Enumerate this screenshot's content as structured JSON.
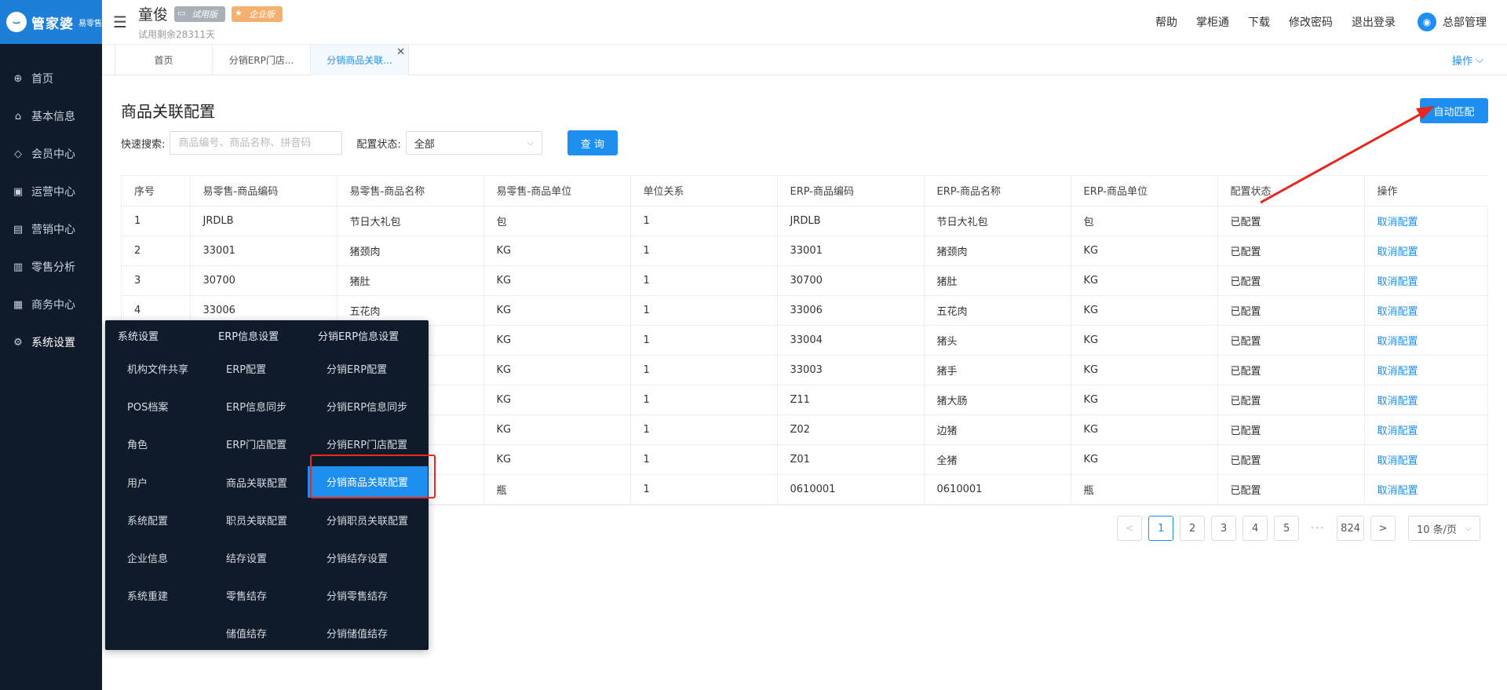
{
  "sidebar": {
    "logo_text": "管家婆",
    "logo_sub": "易零售",
    "items": [
      {
        "label": "首页",
        "icon": "globe-icon",
        "glyph": "⊕"
      },
      {
        "label": "基本信息",
        "icon": "home-icon",
        "glyph": "⌂"
      },
      {
        "label": "会员中心",
        "icon": "diamond-icon",
        "glyph": "◇"
      },
      {
        "label": "运营中心",
        "icon": "operations-icon",
        "glyph": "▣"
      },
      {
        "label": "营销中心",
        "icon": "gift-icon",
        "glyph": "▤"
      },
      {
        "label": "零售分析",
        "icon": "bar-chart-icon",
        "glyph": "▥"
      },
      {
        "label": "商务中心",
        "icon": "briefcase-icon",
        "glyph": "▦"
      },
      {
        "label": "系统设置",
        "icon": "gear-icon",
        "glyph": "⚙"
      }
    ]
  },
  "header": {
    "user_name": "童俊",
    "badge_trial": "试用版",
    "badge_enterprise": "企业版",
    "trial_remaining": "试用剩余28311天",
    "links": [
      "帮助",
      "掌柜通",
      "下载",
      "修改密码",
      "退出登录"
    ],
    "admin_label": "总部管理"
  },
  "tabs": {
    "items": [
      "首页",
      "分销ERP门店...",
      "分销商品关联..."
    ],
    "active_index": 2,
    "ops_label": "操作"
  },
  "main": {
    "title": "商品关联配置",
    "auto_match_label": "自动匹配",
    "search_label": "快速搜索:",
    "search_placeholder": "商品编号、商品名称、拼音码",
    "status_label": "配置状态:",
    "status_value": "全部",
    "query_label": "查 询"
  },
  "table": {
    "headers": [
      "序号",
      "易零售-商品编码",
      "易零售-商品名称",
      "易零售-商品单位",
      "单位关系",
      "ERP-商品编码",
      "ERP-商品名称",
      "ERP-商品单位",
      "配置状态",
      "操作"
    ],
    "rows": [
      [
        "1",
        "JRDLB",
        "节日大礼包",
        "包",
        "1",
        "JRDLB",
        "节日大礼包",
        "包",
        "已配置",
        "取消配置"
      ],
      [
        "2",
        "33001",
        "猪颈肉",
        "KG",
        "1",
        "33001",
        "猪颈肉",
        "KG",
        "已配置",
        "取消配置"
      ],
      [
        "3",
        "30700",
        "猪肚",
        "KG",
        "1",
        "30700",
        "猪肚",
        "KG",
        "已配置",
        "取消配置"
      ],
      [
        "4",
        "33006",
        "五花肉",
        "KG",
        "1",
        "33006",
        "五花肉",
        "KG",
        "已配置",
        "取消配置"
      ],
      [
        "",
        "",
        "",
        "KG",
        "1",
        "33004",
        "猪头",
        "KG",
        "已配置",
        "取消配置"
      ],
      [
        "",
        "",
        "",
        "KG",
        "1",
        "33003",
        "猪手",
        "KG",
        "已配置",
        "取消配置"
      ],
      [
        "",
        "",
        "",
        "KG",
        "1",
        "Z11",
        "猪大肠",
        "KG",
        "已配置",
        "取消配置"
      ],
      [
        "",
        "",
        "",
        "KG",
        "1",
        "Z02",
        "边猪",
        "KG",
        "已配置",
        "取消配置"
      ],
      [
        "",
        "",
        "",
        "KG",
        "1",
        "Z01",
        "全猪",
        "KG",
        "已配置",
        "取消配置"
      ],
      [
        "",
        "",
        "",
        "瓶",
        "1",
        "0610001",
        "0610001",
        "瓶",
        "已配置",
        "取消配置"
      ]
    ]
  },
  "pagination": {
    "prev": "<",
    "pages": [
      "1",
      "2",
      "3",
      "4",
      "5"
    ],
    "ellipsis": "···",
    "last": "824",
    "next": ">",
    "current": "1",
    "page_size": "10 条/页"
  },
  "flyout": {
    "columns": [
      {
        "head": "系统设置",
        "items": [
          "机构文件共享",
          "POS档案",
          "角色",
          "用户",
          "系统配置",
          "企业信息",
          "系统重建"
        ]
      },
      {
        "head": "ERP信息设置",
        "items": [
          "ERP配置",
          "ERP信息同步",
          "ERP门店配置",
          "商品关联配置",
          "职员关联配置",
          "结存设置",
          "零售结存",
          "储值结存"
        ]
      },
      {
        "head": "分销ERP信息设置",
        "items": [
          "分销ERP配置",
          "分销ERP信息同步",
          "分销ERP门店配置",
          "分销商品关联配置",
          "分销职员关联配置",
          "分销结存设置",
          "分销零售结存",
          "分销储值结存"
        ]
      }
    ],
    "selected": "分销商品关联配置"
  },
  "colors": {
    "accent": "#1e8ff0",
    "sidebar_bg": "#0f1b2b",
    "annotation_red": "#e8271f"
  }
}
